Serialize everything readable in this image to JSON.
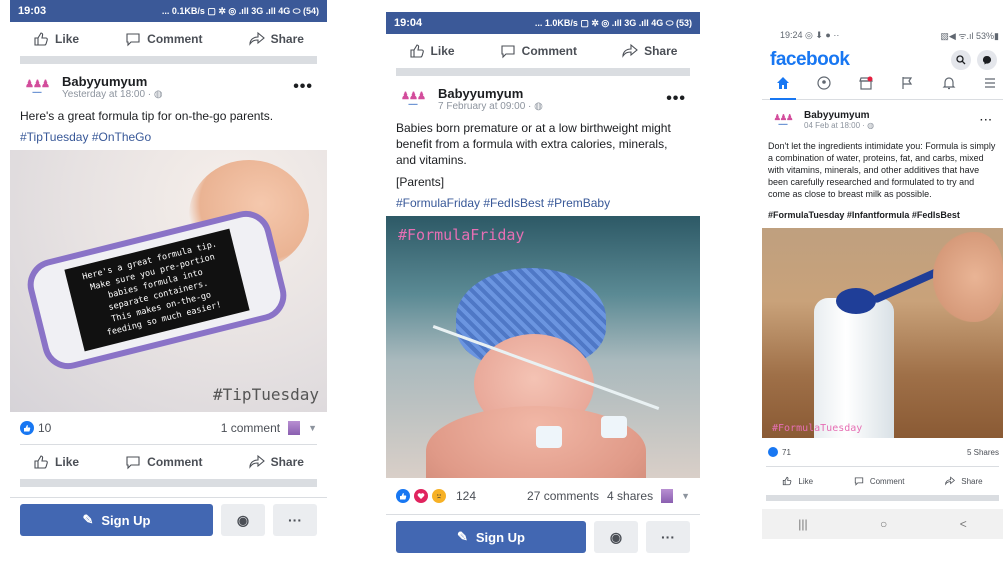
{
  "phone1": {
    "status": {
      "time": "19:03",
      "right": "... 0.1KB/s ▢ ✲ ◎ .ıll 3G .ıll 4G ⬭ (54)"
    },
    "actions_top": {
      "like": "Like",
      "comment": "Comment",
      "share": "Share"
    },
    "post": {
      "page_name": "Babyyumyum",
      "time": "Yesterday at 18:00 · ",
      "text": "Here's a great formula tip for on-the-go parents.",
      "hashtags": "#TipTuesday #OnTheGo",
      "image_text": [
        "Here's a great formula tip.",
        "Make sure you pre-portion",
        "babies formula into",
        "separate containers.",
        "This makes on-the-go",
        "feeding so much easier!"
      ],
      "image_tag": "#TipTuesday",
      "reaction_count": "10",
      "comments": "1 comment"
    },
    "actions_bottom": {
      "like": "Like",
      "comment": "Comment",
      "share": "Share"
    },
    "signup": "Sign Up"
  },
  "phone2": {
    "status": {
      "time": "19:04",
      "right": "... 1.0KB/s ▢ ✲ ◎ .ıll 3G .ıll 4G ⬭ (53)"
    },
    "actions_top": {
      "like": "Like",
      "comment": "Comment",
      "share": "Share"
    },
    "post": {
      "page_name": "Babyyumyum",
      "time": "7 February at 09:00 · ",
      "text": "Babies born premature or at a low birthweight might benefit from a formula with extra calories, minerals, and vitamins.",
      "text2": "[Parents]",
      "hashtags": "#FormulaFriday #FedIsBest #PremBaby",
      "image_tag": "#FormulaFriday",
      "reaction_count": "124",
      "comments": "27 comments",
      "shares": "4 shares"
    },
    "signup": "Sign Up"
  },
  "phone3": {
    "status": {
      "time": "19:24 ◎ ⬇ ● ··",
      "right": "▧◀ ᯤ.ıl 53%▮"
    },
    "logo": "facebook",
    "post": {
      "page_name": "Babyyumyum",
      "time": "04 Feb at 18:00 · ",
      "text": "Don't let the ingredients intimidate you: Formula is simply a combination of water, proteins, fat, and carbs, mixed with vitamins, minerals, and other additives that have been carefully researched and formulated to try and come as close to breast milk as possible.",
      "hashtags": "#FormulaTuesday #Infantformula #FedIsBest",
      "image_tag": "#FormulaTuesday",
      "reaction_count": "71",
      "shares": "5 Shares"
    },
    "actions": {
      "like": "Like",
      "comment": "Comment",
      "share": "Share"
    },
    "nav_buttons": [
      "|||",
      "○",
      "<"
    ]
  },
  "colors": {
    "fb_blue": "#3b5998",
    "link": "#385898",
    "brand_blue": "#1877f2",
    "signup": "#4267b2"
  }
}
